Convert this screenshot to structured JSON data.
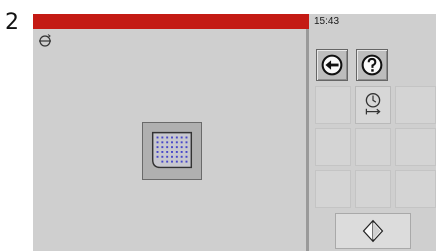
{
  "step_number": "2",
  "status_bar": {
    "time": "15:43",
    "accent_color": "#c41a14"
  },
  "icons": {
    "mode": "rotation-mode-icon",
    "cooking": "steam-grid-cooking-icon",
    "back": "back-arrow-icon",
    "help": "question-mark-icon",
    "program": "timer-clock-icon",
    "start": "start-diamond-icon"
  }
}
